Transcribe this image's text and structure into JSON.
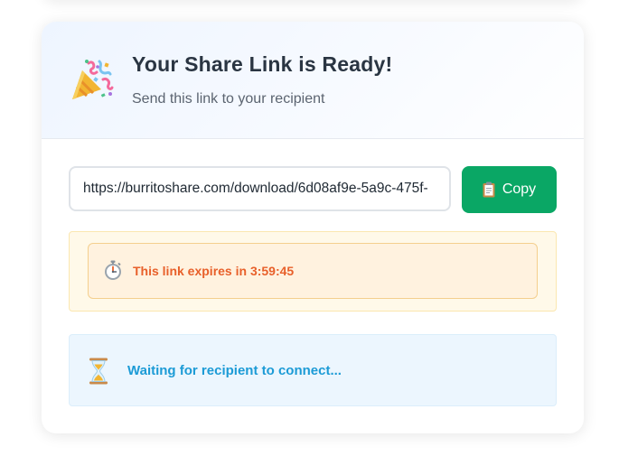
{
  "header": {
    "title": "Your Share Link is Ready!",
    "subtitle": "Send this link to your recipient",
    "icon": "party-popper-icon"
  },
  "link": {
    "value": "https://burritoshare.com/download/6d08af9e-5a9c-475f-"
  },
  "copy_button": {
    "label": "Copy",
    "icon": "clipboard-icon",
    "color": "#0aa765"
  },
  "expiry": {
    "prefix": "This link expires in ",
    "time": "3:59:45",
    "icon": "stopwatch-icon",
    "color": "#e8602a"
  },
  "waiting": {
    "text": "Waiting for recipient to connect...",
    "icon": "hourglass-icon",
    "color": "#1c9bd6"
  }
}
